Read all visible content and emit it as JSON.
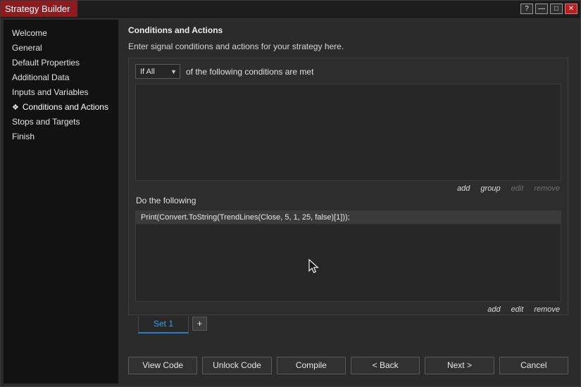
{
  "window": {
    "title": "Strategy Builder",
    "controls": {
      "help": "?",
      "minimize": "—",
      "maximize": "□",
      "close": "✕"
    }
  },
  "sidebar": {
    "items": [
      {
        "label": "Welcome",
        "selected": false
      },
      {
        "label": "General",
        "selected": false
      },
      {
        "label": "Default Properties",
        "selected": false
      },
      {
        "label": "Additional Data",
        "selected": false
      },
      {
        "label": "Inputs and Variables",
        "selected": false
      },
      {
        "label": "Conditions and Actions",
        "selected": true,
        "marker": "❖"
      },
      {
        "label": "Stops and Targets",
        "selected": false
      },
      {
        "label": "Finish",
        "selected": false
      }
    ]
  },
  "main": {
    "title": "Conditions and Actions",
    "subtitle": "Enter signal conditions and actions for your strategy here.",
    "conditions": {
      "dropdown_value": "If All",
      "suffix": "of the following conditions are met",
      "links": {
        "add": "add",
        "group": "group",
        "edit": "edit",
        "remove": "remove"
      }
    },
    "actions": {
      "label": "Do the following",
      "rows": [
        "Print(Convert.ToString(TrendLines(Close, 5, 1, 25, false)[1]));"
      ],
      "links": {
        "add": "add",
        "edit": "edit",
        "remove": "remove"
      }
    },
    "tabs": {
      "set1": "Set 1",
      "add": "+"
    },
    "buttons": {
      "view_code": "View Code",
      "unlock_code": "Unlock Code",
      "compile": "Compile",
      "back": "< Back",
      "next": "Next >",
      "cancel": "Cancel"
    }
  }
}
